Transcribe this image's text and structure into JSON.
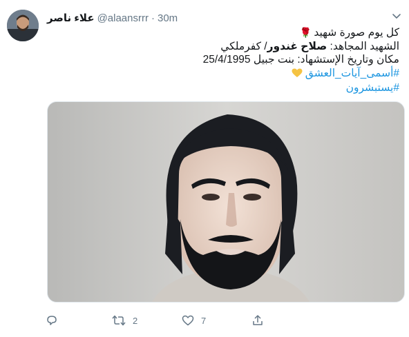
{
  "header": {
    "display_name": "علاء ناصر",
    "handle": "@alaansrrr",
    "separator": "·",
    "time": "30m"
  },
  "body": {
    "line1": "كل يوم صورة شهيد",
    "line2_prefix": "الشهيد المجاهد: ",
    "line2_name": "صلاح غندور",
    "line2_suffix": "/ كفرملكي",
    "line3": "مكان وتاريخ الإستشهاد: بنت جبيل 25/4/1995",
    "hashtag1": "#أسمى_آيات_العشق",
    "hashtag2": "#يستبشرون"
  },
  "icons": {
    "rose": "rose-icon",
    "heart": "yellow-heart-icon",
    "caret": "chevron-down-icon",
    "reply": "reply-icon",
    "retweet": "retweet-icon",
    "like": "like-icon",
    "share": "share-icon"
  },
  "actions": {
    "reply_count": "",
    "retweet_count": "2",
    "like_count": "7"
  },
  "colors": {
    "link": "#1b95e0",
    "muted": "#657786",
    "heart": "#f5c342",
    "rose": "#c8102e"
  }
}
